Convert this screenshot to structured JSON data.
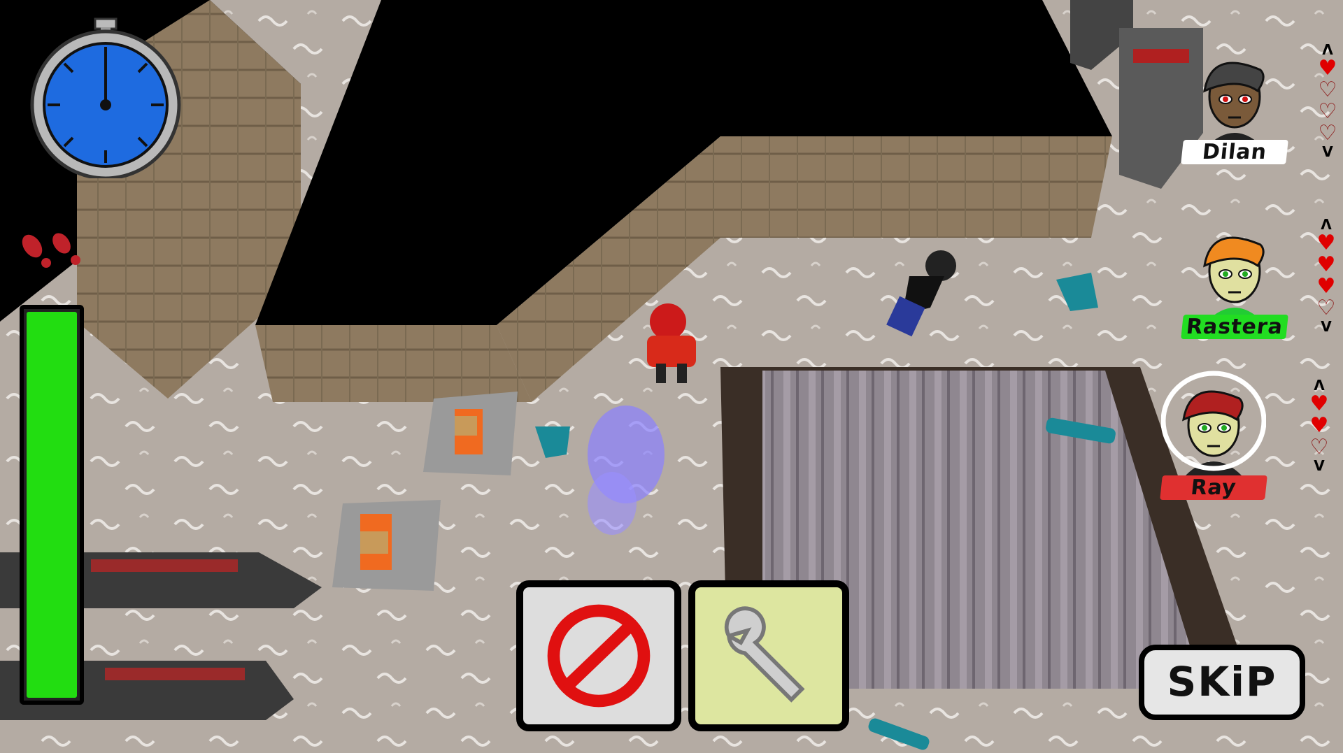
{
  "timer": {
    "icon": "stopwatch-icon",
    "face_color": "#1e6be0"
  },
  "footprints": {
    "icon": "footprints-icon",
    "color": "#c0222a"
  },
  "stamina": {
    "level": 1.0,
    "color": "#22dd11"
  },
  "party": [
    {
      "name": "Dilan",
      "hearts_full": 1,
      "hearts_total": 4,
      "selected": false,
      "hair": "#444444",
      "skin": "#7a5a3a",
      "name_bg": "#ffffff"
    },
    {
      "name": "Rastera",
      "hearts_full": 3,
      "hearts_total": 4,
      "selected": false,
      "hair": "#f08a20",
      "skin": "#e0e0a0",
      "name_bg": "#22dd22"
    },
    {
      "name": "Ray",
      "hearts_full": 2,
      "hearts_total": 3,
      "selected": true,
      "hair": "#b02020",
      "skin": "#e0e0a0",
      "name_bg": "#e03030"
    }
  ],
  "hearts_up_arrow": "Λ",
  "hearts_down_arrow": "V",
  "actions": [
    {
      "name": "cancel",
      "icon": "prohibited-icon",
      "bg": "#dddddd"
    },
    {
      "name": "repair",
      "icon": "wrench-icon",
      "bg": "#dde6a0"
    }
  ],
  "skip_label": "SKiP"
}
